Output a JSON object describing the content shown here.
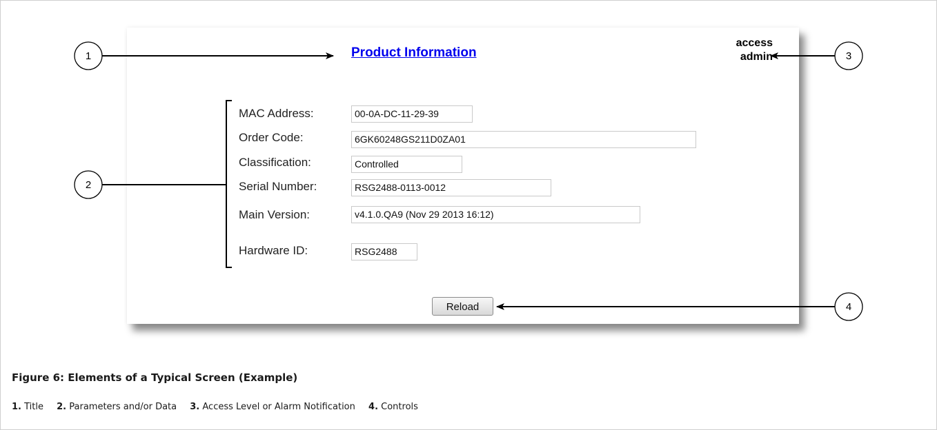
{
  "screen": {
    "title": "Product Information",
    "access": {
      "line1": "access",
      "line2": "admin"
    },
    "fields": [
      {
        "label": "MAC Address:",
        "value": "00-0A-DC-11-29-39"
      },
      {
        "label": "Order Code:",
        "value": "6GK60248GS211D0ZA01"
      },
      {
        "label": "Classification:",
        "value": "Controlled"
      },
      {
        "label": "Serial Number:",
        "value": "RSG2488-0113-0012"
      },
      {
        "label": "Main Version:",
        "value": "v4.1.0.QA9 (Nov 29 2013 16:12)"
      },
      {
        "label": "Hardware ID:",
        "value": "RSG2488"
      }
    ],
    "reload_label": "Reload"
  },
  "callouts": [
    "1",
    "2",
    "3",
    "4"
  ],
  "caption": "Figure 6: Elements of a Typical Screen (Example)",
  "legend": [
    {
      "num": "1.",
      "text": "Title"
    },
    {
      "num": "2.",
      "text": "Parameters and/or Data"
    },
    {
      "num": "3.",
      "text": "Access Level or Alarm Notification"
    },
    {
      "num": "4.",
      "text": "Controls"
    }
  ]
}
